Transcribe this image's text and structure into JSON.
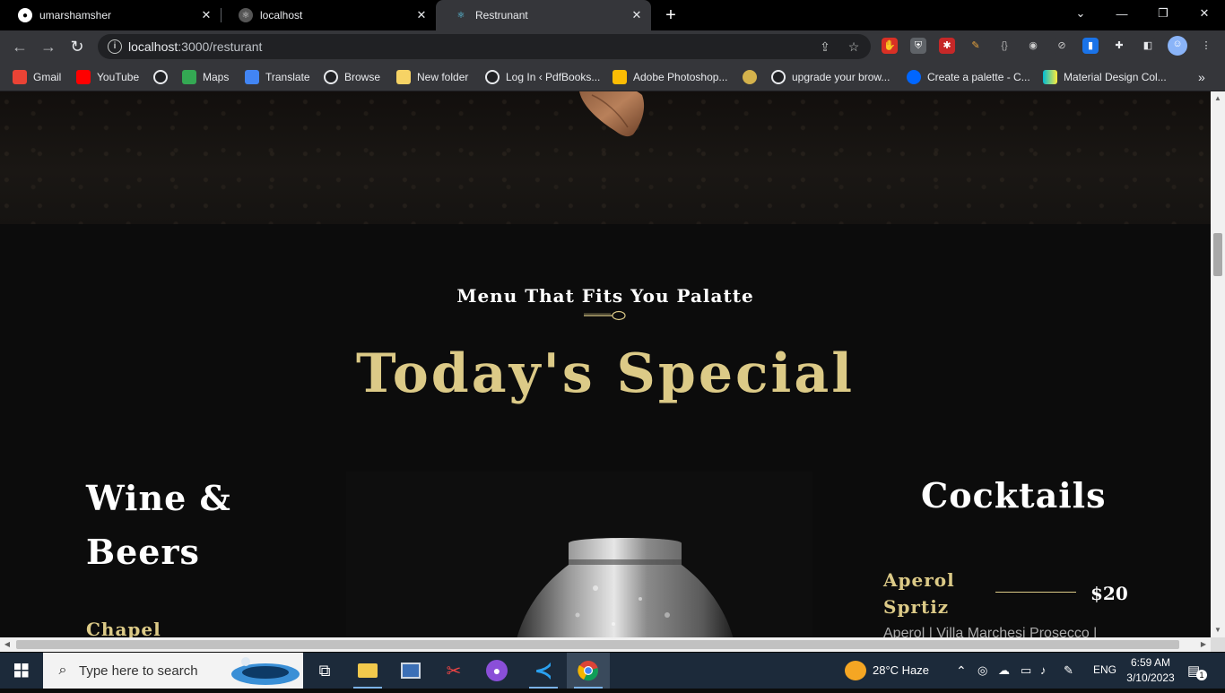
{
  "browser": {
    "tabs": [
      {
        "title": "umarshamsher",
        "icon": "github-icon",
        "active": false
      },
      {
        "title": "localhost",
        "icon": "react-icon",
        "active": false
      },
      {
        "title": "Restrunant",
        "icon": "react-icon",
        "active": true
      }
    ],
    "url_host": "localhost",
    "url_path": ":3000/resturant",
    "bookmarks": [
      {
        "label": "Gmail",
        "icon": "gmail-icon",
        "color": "#ea4335"
      },
      {
        "label": "YouTube",
        "icon": "youtube-icon",
        "color": "#ff0000"
      },
      {
        "label": "",
        "icon": "globe-icon",
        "color": "#202124"
      },
      {
        "label": "Maps",
        "icon": "maps-icon",
        "color": "#34a853"
      },
      {
        "label": "Translate",
        "icon": "translate-icon",
        "color": "#4285f4"
      },
      {
        "label": "Browse",
        "icon": "globe-icon",
        "color": "#202124"
      },
      {
        "label": "New folder",
        "icon": "folder-icon",
        "color": "#f6d365"
      },
      {
        "label": "Log In ‹ PdfBooks...",
        "icon": "globe-icon",
        "color": "#202124"
      },
      {
        "label": "Adobe Photoshop...",
        "icon": "google-drive-icon",
        "color": "#fbbc04"
      },
      {
        "label": "",
        "icon": "eye-icon",
        "color": "#d4b24c"
      },
      {
        "label": "upgrade your brow...",
        "icon": "globe-icon",
        "color": "#202124"
      },
      {
        "label": "Create a palette - C...",
        "icon": "coolors-icon",
        "color": "#0066ff"
      },
      {
        "label": "Material Design Col...",
        "icon": "material-icon",
        "color": "#00bcd4"
      }
    ]
  },
  "page": {
    "subtitle": "Menu That Fits You Palatte",
    "heading": "Today's Special",
    "wine_heading": "Wine & Beers",
    "wine_first_item": "Chapel",
    "cocktails_heading": "Cocktails",
    "cocktail": {
      "name": "Aperol Sprtiz",
      "price": "$20",
      "description": "Aperol | Villa Marchesi Prosecco |"
    },
    "accent_color": "#dcca87"
  },
  "taskbar": {
    "search_placeholder": "Type here to search",
    "weather": "28°C  Haze",
    "language": "ENG",
    "time": "6:59 AM",
    "date": "3/10/2023",
    "notification_count": "1"
  }
}
